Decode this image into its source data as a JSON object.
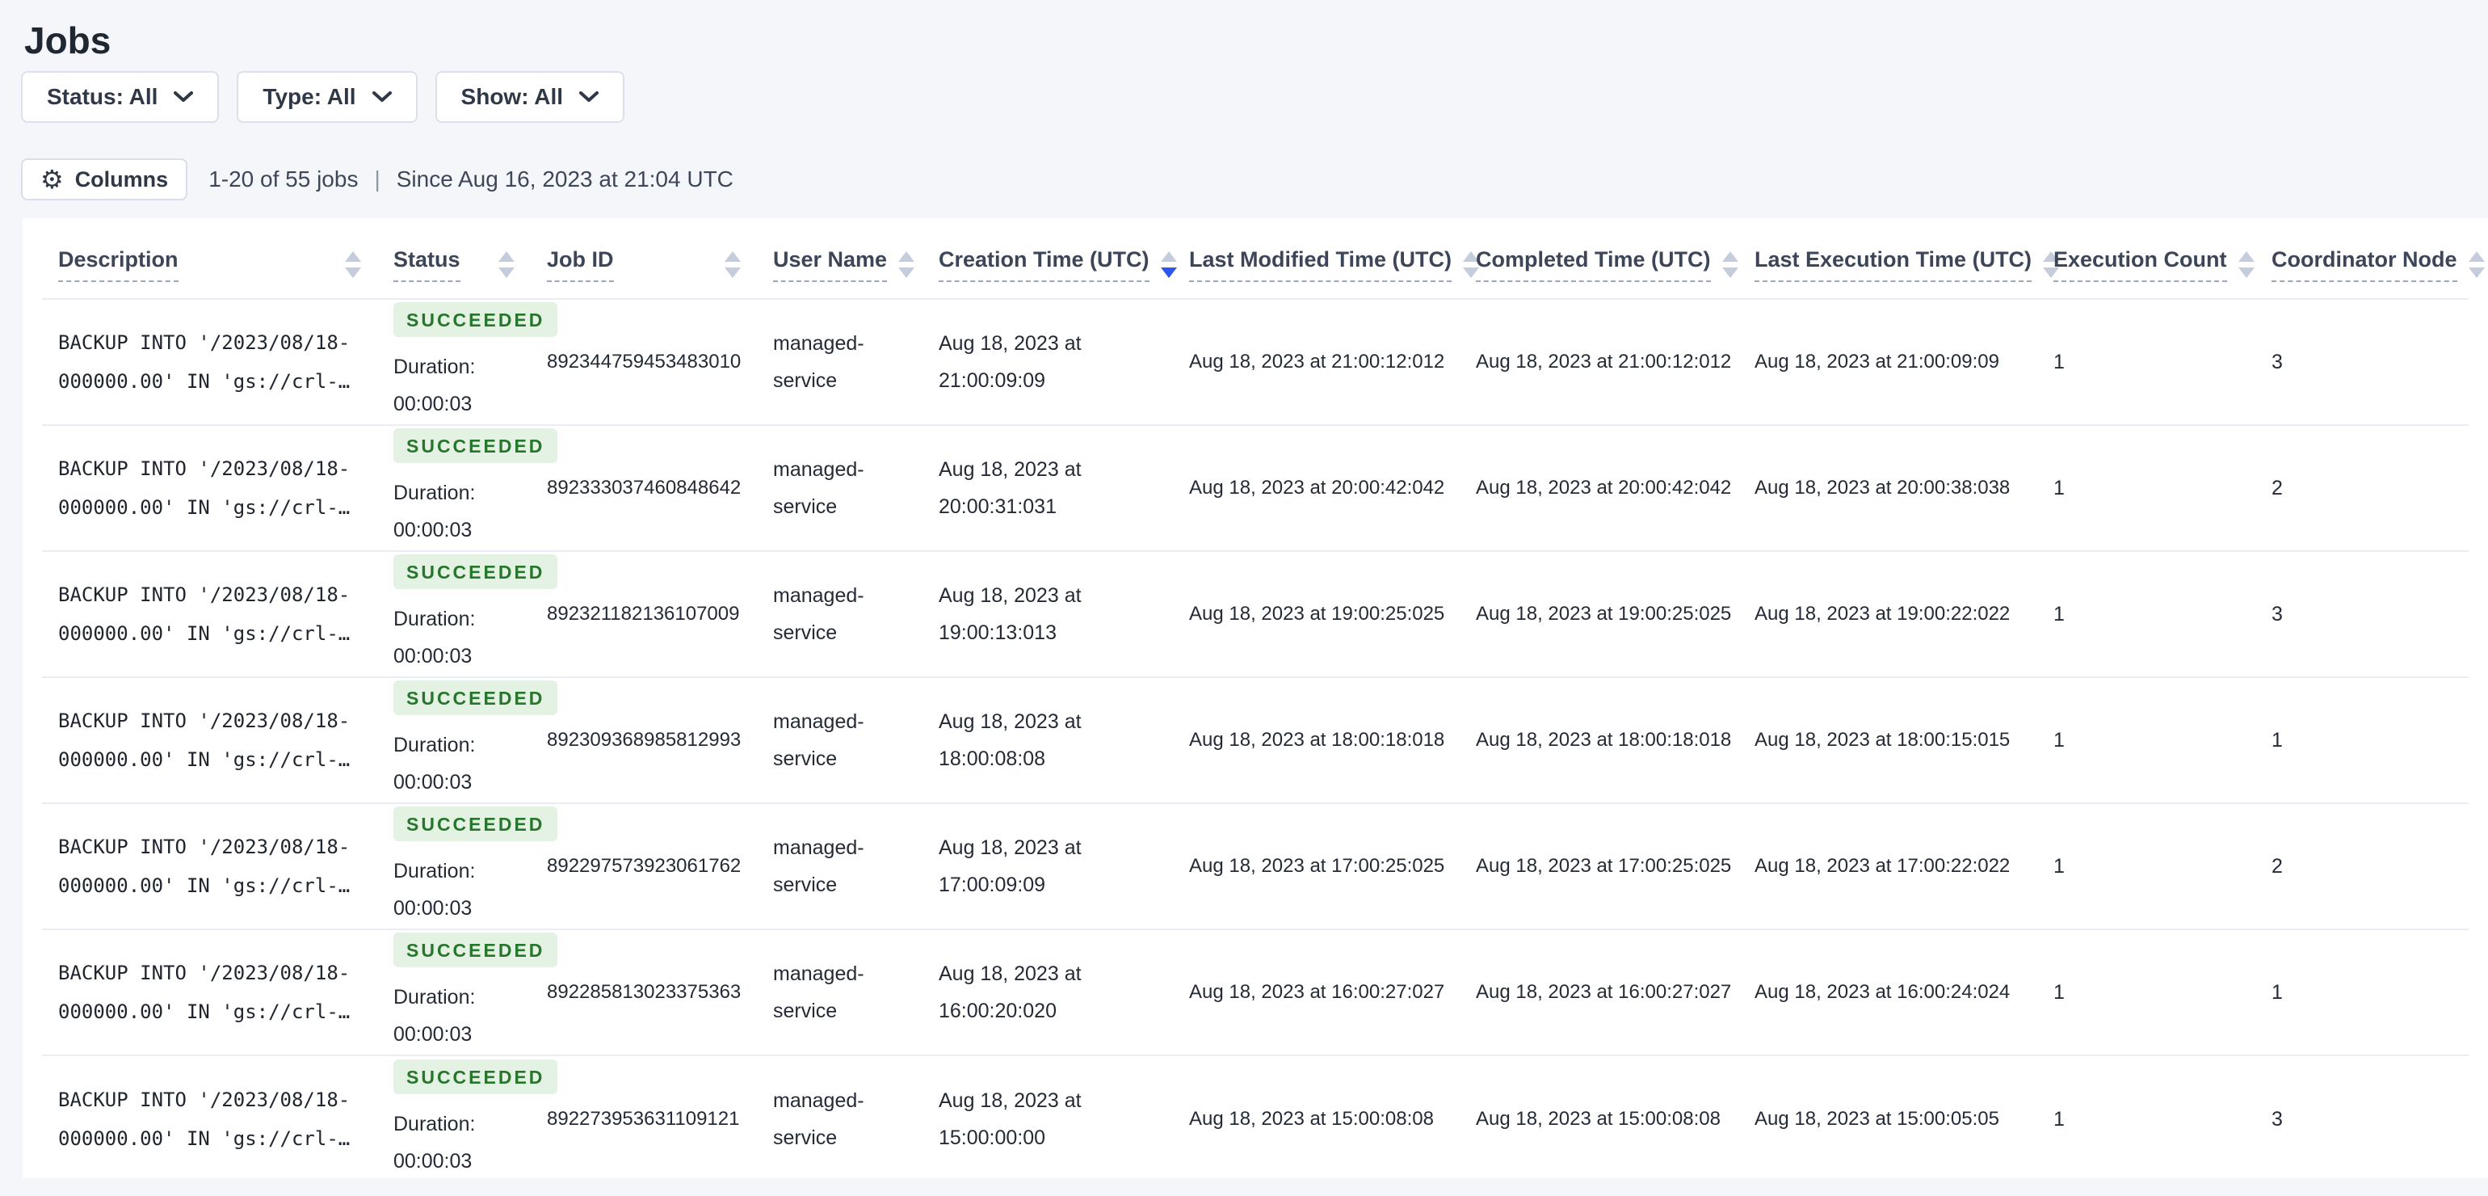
{
  "page": {
    "title": "Jobs"
  },
  "filters": {
    "status": {
      "label": "Status: All"
    },
    "type": {
      "label": "Type: All"
    },
    "show": {
      "label": "Show: All"
    }
  },
  "toolbar": {
    "columns_label": "Columns",
    "jobs_count": "1-20 of 55 jobs",
    "divider": "|",
    "since": "Since Aug 16, 2023 at 21:04 UTC"
  },
  "sort": {
    "column": "Creation Time (UTC)",
    "direction": "desc"
  },
  "colors": {
    "accent_sort_arrow": "#2d56f0",
    "success_badge_text": "#26772c",
    "success_badge_bg": "#e4f2e3",
    "page_background": "#f4f6fa"
  },
  "table": {
    "duration_label": "Duration:",
    "columns": [
      {
        "label": "Description"
      },
      {
        "label": "Status"
      },
      {
        "label": "Job ID"
      },
      {
        "label": "User Name"
      },
      {
        "label": "Creation Time (UTC)"
      },
      {
        "label": "Last Modified Time (UTC)"
      },
      {
        "label": "Completed Time (UTC)"
      },
      {
        "label": "Last Execution Time (UTC)"
      },
      {
        "label": "Execution Count"
      },
      {
        "label": "Coordinator Node"
      }
    ],
    "rows": [
      {
        "description": [
          "BACKUP INTO '/2023/08/18-",
          "000000.00' IN 'gs://crl-…"
        ],
        "status": "SUCCEEDED",
        "duration": "00:00:03",
        "job_id": "892344759453483010",
        "user_name": "managed-service",
        "creation_time": "Aug 18, 2023 at 21:00:09:09",
        "last_modified_time": "Aug 18, 2023 at 21:00:12:012",
        "completed_time": "Aug 18, 2023 at 21:00:12:012",
        "last_execution_time": "Aug 18, 2023 at 21:00:09:09",
        "execution_count": "1",
        "coordinator_node": "3"
      },
      {
        "description": [
          "BACKUP INTO '/2023/08/18-",
          "000000.00' IN 'gs://crl-…"
        ],
        "status": "SUCCEEDED",
        "duration": "00:00:03",
        "job_id": "892333037460848642",
        "user_name": "managed-service",
        "creation_time": "Aug 18, 2023 at 20:00:31:031",
        "last_modified_time": "Aug 18, 2023 at 20:00:42:042",
        "completed_time": "Aug 18, 2023 at 20:00:42:042",
        "last_execution_time": "Aug 18, 2023 at 20:00:38:038",
        "execution_count": "1",
        "coordinator_node": "2"
      },
      {
        "description": [
          "BACKUP INTO '/2023/08/18-",
          "000000.00' IN 'gs://crl-…"
        ],
        "status": "SUCCEEDED",
        "duration": "00:00:03",
        "job_id": "892321182136107009",
        "user_name": "managed-service",
        "creation_time": "Aug 18, 2023 at 19:00:13:013",
        "last_modified_time": "Aug 18, 2023 at 19:00:25:025",
        "completed_time": "Aug 18, 2023 at 19:00:25:025",
        "last_execution_time": "Aug 18, 2023 at 19:00:22:022",
        "execution_count": "1",
        "coordinator_node": "3"
      },
      {
        "description": [
          "BACKUP INTO '/2023/08/18-",
          "000000.00' IN 'gs://crl-…"
        ],
        "status": "SUCCEEDED",
        "duration": "00:00:03",
        "job_id": "892309368985812993",
        "user_name": "managed-service",
        "creation_time": "Aug 18, 2023 at 18:00:08:08",
        "last_modified_time": "Aug 18, 2023 at 18:00:18:018",
        "completed_time": "Aug 18, 2023 at 18:00:18:018",
        "last_execution_time": "Aug 18, 2023 at 18:00:15:015",
        "execution_count": "1",
        "coordinator_node": "1"
      },
      {
        "description": [
          "BACKUP INTO '/2023/08/18-",
          "000000.00' IN 'gs://crl-…"
        ],
        "status": "SUCCEEDED",
        "duration": "00:00:03",
        "job_id": "892297573923061762",
        "user_name": "managed-service",
        "creation_time": "Aug 18, 2023 at 17:00:09:09",
        "last_modified_time": "Aug 18, 2023 at 17:00:25:025",
        "completed_time": "Aug 18, 2023 at 17:00:25:025",
        "last_execution_time": "Aug 18, 2023 at 17:00:22:022",
        "execution_count": "1",
        "coordinator_node": "2"
      },
      {
        "description": [
          "BACKUP INTO '/2023/08/18-",
          "000000.00' IN 'gs://crl-…"
        ],
        "status": "SUCCEEDED",
        "duration": "00:00:03",
        "job_id": "892285813023375363",
        "user_name": "managed-service",
        "creation_time": "Aug 18, 2023 at 16:00:20:020",
        "last_modified_time": "Aug 18, 2023 at 16:00:27:027",
        "completed_time": "Aug 18, 2023 at 16:00:27:027",
        "last_execution_time": "Aug 18, 2023 at 16:00:24:024",
        "execution_count": "1",
        "coordinator_node": "1"
      },
      {
        "description": [
          "BACKUP INTO '/2023/08/18-",
          "000000.00' IN 'gs://crl-…"
        ],
        "status": "SUCCEEDED",
        "duration": "00:00:03",
        "job_id": "892273953631109121",
        "user_name": "managed-service",
        "creation_time": "Aug 18, 2023 at 15:00:00:00",
        "last_modified_time": "Aug 18, 2023 at 15:00:08:08",
        "completed_time": "Aug 18, 2023 at 15:00:08:08",
        "last_execution_time": "Aug 18, 2023 at 15:00:05:05",
        "execution_count": "1",
        "coordinator_node": "3"
      }
    ]
  }
}
